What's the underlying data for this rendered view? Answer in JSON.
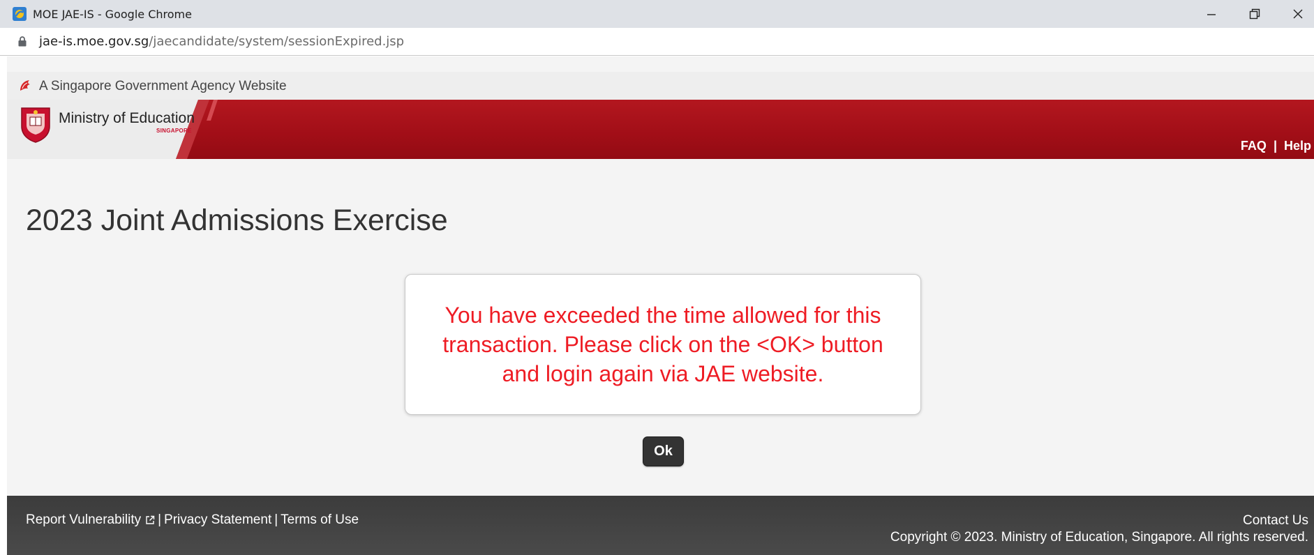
{
  "window": {
    "title": "MOE JAE-IS - Google Chrome",
    "controls": {
      "minimize": "minimize-icon",
      "restore": "restore-icon",
      "close": "close-icon"
    }
  },
  "address_bar": {
    "host": "jae-is.moe.gov.sg",
    "path": "/jaecandidate/system/sessionExpired.jsp"
  },
  "gov_banner": {
    "text": "A Singapore Government Agency Website"
  },
  "header": {
    "ministry_name": "Ministry of Education",
    "ministry_sub": "SINGAPORE",
    "links": {
      "faq": "FAQ",
      "separator": "|",
      "help": "Help"
    }
  },
  "main": {
    "title": "2023 Joint Admissions Exercise",
    "message": "You have exceeded the time allowed for this transaction. Please click on the <OK> button and login again via JAE website.",
    "ok_label": "Ok"
  },
  "footer": {
    "report_vulnerability": "Report Vulnerability",
    "privacy_statement": "Privacy Statement",
    "terms_of_use": "Terms of Use",
    "separator": "|",
    "contact_us": "Contact Us",
    "copyright": "Copyright © 2023. Ministry of Education, Singapore. All rights reserved."
  },
  "colors": {
    "header_red": "#a10e17",
    "message_red": "#ee1c24",
    "footer_bg": "#444444",
    "button_bg": "#333333",
    "page_bg": "#f4f4f4"
  }
}
